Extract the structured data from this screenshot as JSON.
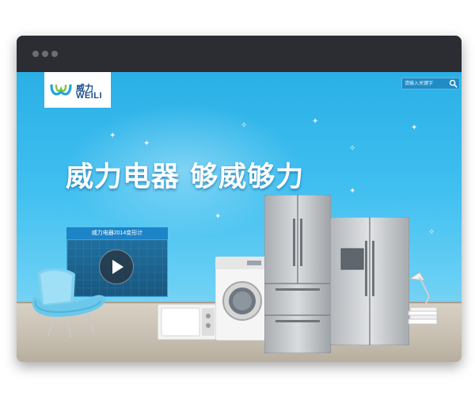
{
  "window": {
    "controls": [
      "dot-1",
      "dot-2",
      "dot-3"
    ]
  },
  "header": {
    "logo_cn": "威力",
    "logo_en": "WEILI",
    "search": {
      "placeholder": "请输入关键字",
      "value": ""
    }
  },
  "hero": {
    "headline": "威力电器 够威够力",
    "video_label": "威力电器2014变形计"
  },
  "colors": {
    "sky": "#2ab0e6",
    "brand_blue": "#1d84c8",
    "logo_text": "#1a4f8f"
  },
  "icons": [
    "search-icon",
    "play-icon",
    "logo-mark-icon"
  ]
}
